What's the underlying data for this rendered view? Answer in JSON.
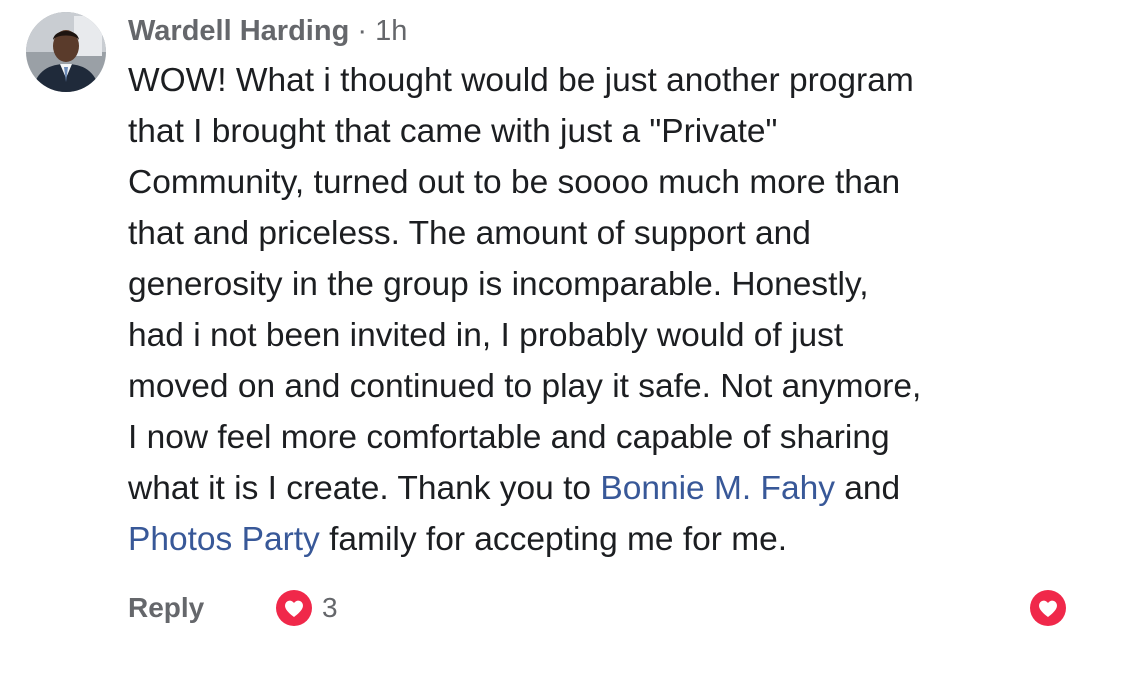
{
  "comment": {
    "author": "Wardell Harding",
    "separator": " · ",
    "time": "1h",
    "text_lines": [
      "WOW! What i thought would be just another program",
      "that I brought that came with just a \"Private\"",
      "Community, turned out to be soooo much more than",
      "that and priceless. The amount of support and",
      "generosity in the group is incomparable. Honestly,",
      "had i not been invited in, I probably would of just",
      "moved on and continued to play it safe. Not anymore,",
      "I now feel more comfortable and capable of sharing"
    ],
    "line9_pre": "what it is I create. Thank you to ",
    "mention_1": "Bonnie M. Fahy",
    "line9_post": " and",
    "mention_2": "Photos Party",
    "line10_post": " family for accepting me for me.",
    "reply_label": "Reply",
    "reaction_count": "3",
    "reaction_icon": "love-icon",
    "like_icon": "love-icon",
    "colors": {
      "mention": "#385898",
      "love": "#f0284a",
      "meta": "#65676b",
      "text": "#1c1e21"
    }
  }
}
